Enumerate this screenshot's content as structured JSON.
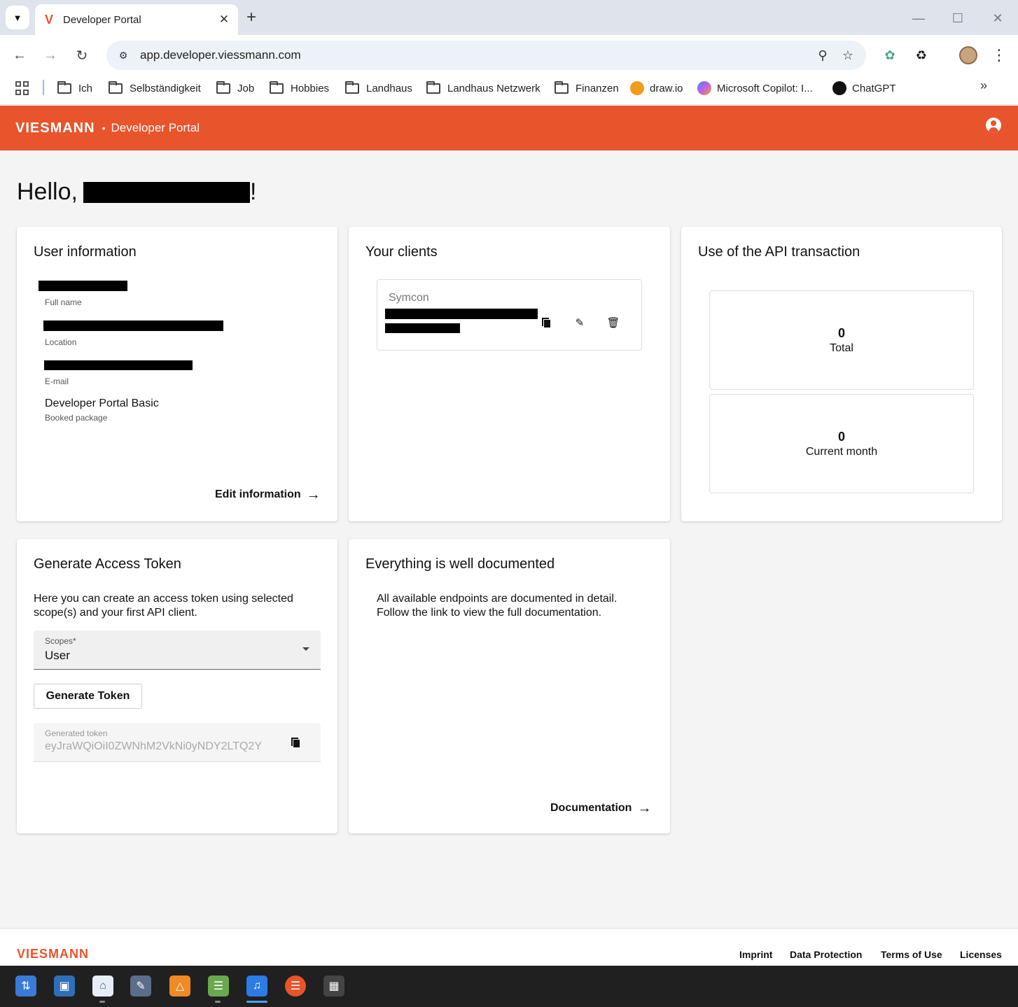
{
  "browser": {
    "tab_title": "Developer Portal",
    "tab_favicon_letter": "V",
    "url": "app.developer.viessmann.com",
    "bookmarks": [
      {
        "label": "Ich",
        "icon": "folder-icon"
      },
      {
        "label": "Selbständigkeit",
        "icon": "folder-icon"
      },
      {
        "label": "Job",
        "icon": "folder-icon"
      },
      {
        "label": "Hobbies",
        "icon": "folder-icon"
      },
      {
        "label": "Landhaus",
        "icon": "folder-icon"
      },
      {
        "label": "Landhaus Netzwerk",
        "icon": "folder-icon"
      },
      {
        "label": "Finanzen",
        "icon": "folder-icon"
      },
      {
        "label": "draw.io",
        "icon": "drawio-icon"
      },
      {
        "label": "Microsoft Copilot: I...",
        "icon": "copilot-icon"
      },
      {
        "label": "ChatGPT",
        "icon": "chatgpt-icon"
      }
    ]
  },
  "header": {
    "logo": "VIESMANN",
    "separator": "•",
    "subtitle": "Developer Portal"
  },
  "greeting": {
    "prefix": "Hello,",
    "suffix": "!"
  },
  "user_info": {
    "title": "User information",
    "full_name_label": "Full name",
    "location_label": "Location",
    "email_label": "E-mail",
    "package_value": "Developer Portal Basic",
    "package_label": "Booked package",
    "edit_link": "Edit information"
  },
  "clients": {
    "title": "Your clients",
    "client_name": "Symcon"
  },
  "api_usage": {
    "title": "Use of the API transaction",
    "total_value": "0",
    "total_label": "Total",
    "month_value": "0",
    "month_label": "Current month"
  },
  "token": {
    "title": "Generate Access Token",
    "description": "Here you can create an access token using selected scope(s) and your first API client.",
    "scopes_label": "Scopes*",
    "scopes_value": "User",
    "generate_button": "Generate Token",
    "generated_label": "Generated token",
    "generated_value": "eyJraWQiOiI0ZWNhM2VkNi0yNDY2LTQ2Y"
  },
  "docs": {
    "title": "Everything is well documented",
    "description": "All available endpoints are documented in detail. Follow the link to view the full documentation.",
    "link": "Documentation"
  },
  "footer": {
    "logo": "VIESMANN",
    "links": [
      "Imprint",
      "Data Protection",
      "Terms of Use",
      "Licenses"
    ]
  },
  "colors": {
    "brand": "#e8542b",
    "background": "#f4f4f4"
  }
}
